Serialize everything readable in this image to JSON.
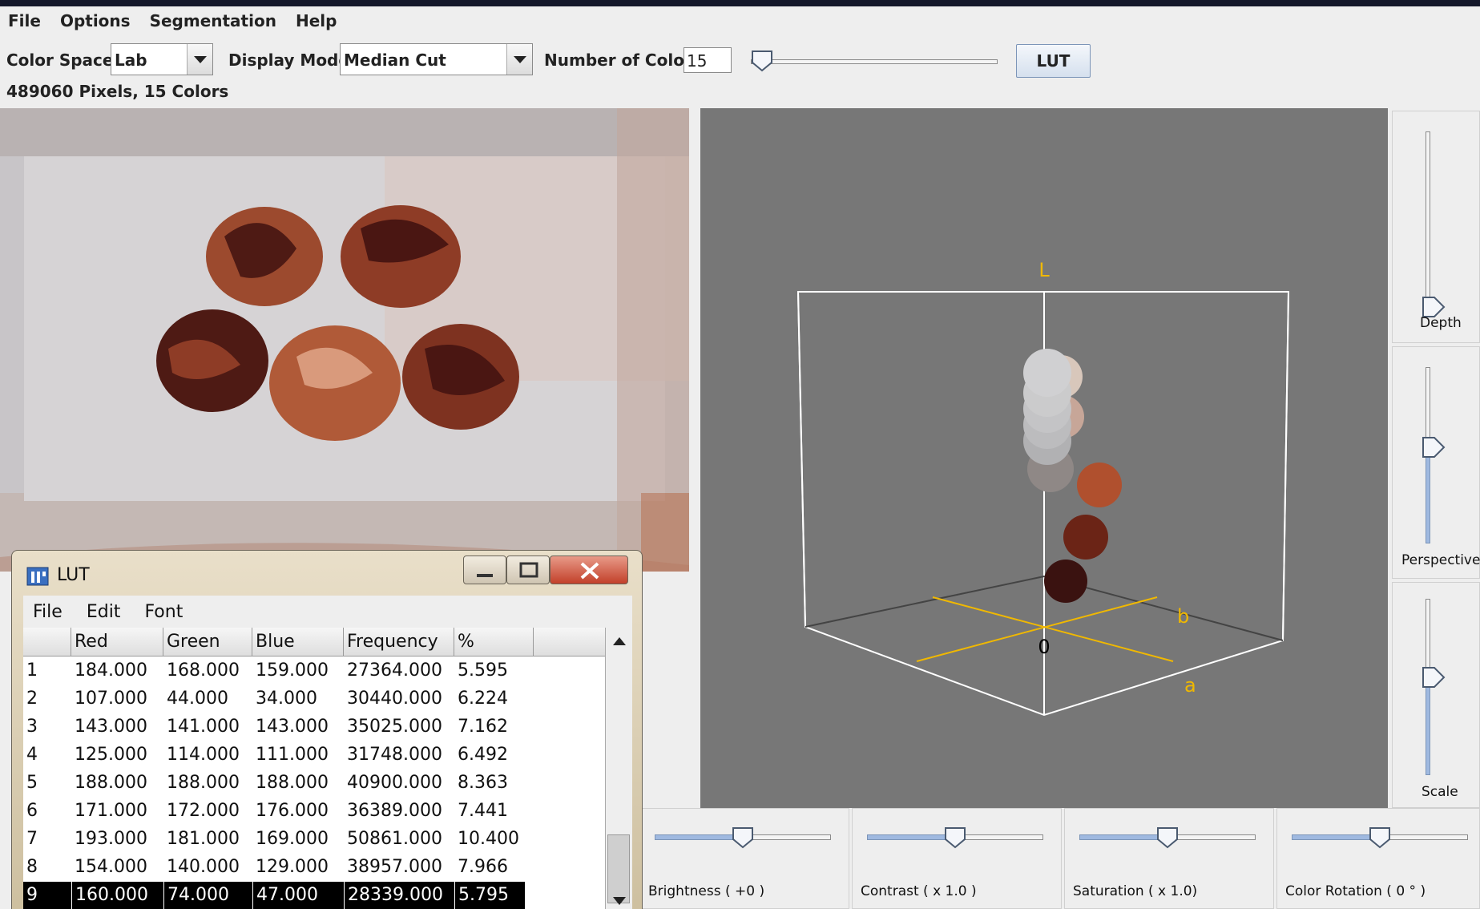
{
  "menubar": {
    "items": [
      "File",
      "Options",
      "Segmentation",
      "Help"
    ]
  },
  "toolbar": {
    "color_space_label": "Color Space:",
    "color_space_value": "Lab",
    "display_mode_label": "Display Mode:",
    "display_mode_value": "Median Cut",
    "num_colors_label": "Number of Colors",
    "num_colors_value": "15",
    "num_colors_slider_fraction": 0.05,
    "lut_button": "LUT"
  },
  "status": "489060 Pixels,  15 Colors",
  "view3d": {
    "axis_l": "L",
    "axis_a": "a",
    "axis_b": "b",
    "origin": "0",
    "axis_color": "#f0b800"
  },
  "side_sliders": [
    {
      "label": "Depth",
      "value_fraction": 0.0
    },
    {
      "label": "Perspective",
      "value_fraction": 0.5
    },
    {
      "label": "Scale",
      "value_fraction": 0.5
    }
  ],
  "bottom_sliders": [
    {
      "label": "Brightness ( +0 )",
      "value_fraction": 0.5
    },
    {
      "label": "Contrast ( x 1.0 )",
      "value_fraction": 0.5
    },
    {
      "label": "Saturation ( x 1.0)",
      "value_fraction": 0.5
    },
    {
      "label": "Color Rotation ( 0 ° )",
      "value_fraction": 0.5
    }
  ],
  "lut_window": {
    "title": "LUT",
    "menu": [
      "File",
      "Edit",
      "Font"
    ],
    "columns": [
      "",
      "Red",
      "Green",
      "Blue",
      "Frequency",
      "%"
    ],
    "rows": [
      [
        "1",
        "184.000",
        "168.000",
        "159.000",
        "27364.000",
        "5.595"
      ],
      [
        "2",
        "107.000",
        "44.000",
        "34.000",
        "30440.000",
        "6.224"
      ],
      [
        "3",
        "143.000",
        "141.000",
        "143.000",
        "35025.000",
        "7.162"
      ],
      [
        "4",
        "125.000",
        "114.000",
        "111.000",
        "31748.000",
        "6.492"
      ],
      [
        "5",
        "188.000",
        "188.000",
        "188.000",
        "40900.000",
        "8.363"
      ],
      [
        "6",
        "171.000",
        "172.000",
        "176.000",
        "36389.000",
        "7.441"
      ],
      [
        "7",
        "193.000",
        "181.000",
        "169.000",
        "50861.000",
        "10.400"
      ],
      [
        "8",
        "154.000",
        "140.000",
        "129.000",
        "38957.000",
        "7.966"
      ],
      [
        "9",
        "160.000",
        "74.000",
        "47.000",
        "28339.000",
        "5.795"
      ]
    ],
    "selected_row": 8
  }
}
